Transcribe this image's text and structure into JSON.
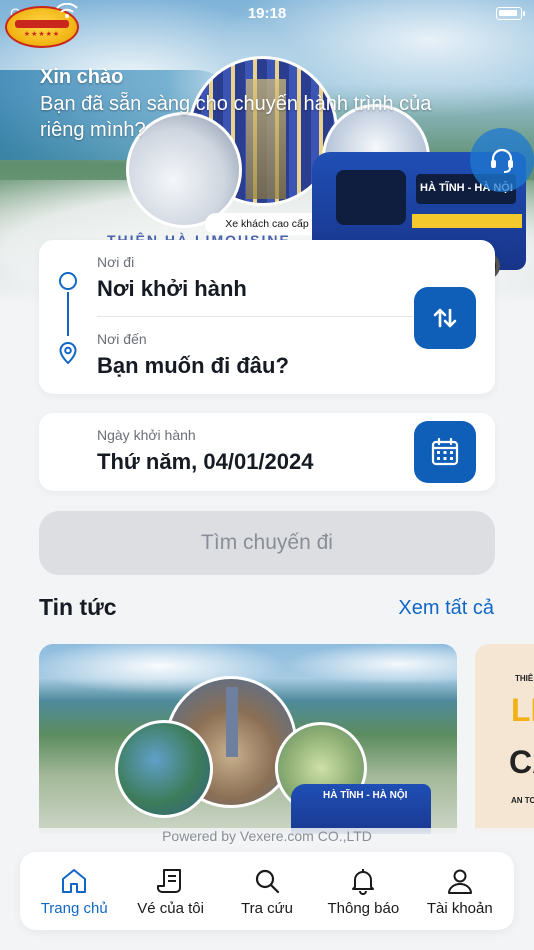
{
  "status_bar": {
    "carrier": "Carrier",
    "time": "19:18"
  },
  "hero": {
    "greeting": "Xin chào",
    "subtitle": "Bạn đã sẵn sàng cho chuyến hành trình của riêng mình?",
    "image_caption": "Xe khách cao cấp",
    "bus_route_text": "HÀ TĨNH - HÀ NỘI",
    "brand_text": "THIÊN HÀ LIMOUSINE"
  },
  "route_form": {
    "from_label": "Nơi đi",
    "from_value": "Nơi khởi hành",
    "to_label": "Nơi đến",
    "to_value": "Bạn muốn đi đâu?"
  },
  "date_form": {
    "label": "Ngày khởi hành",
    "value": "Thứ năm, 04/01/2024"
  },
  "search_button": "Tìm chuyến đi",
  "news": {
    "title": "Tin tức",
    "see_all": "Xem tất cả",
    "card1_bus_text": "HÀ TĨNH - HÀ NỘI",
    "card2_lines": [
      "THIÊ",
      "LI",
      "CA",
      "AN TO"
    ]
  },
  "footer": {
    "powered_by": "Powered by Vexere.com CO.,LTD"
  },
  "tabs": [
    {
      "label": "Trang chủ",
      "icon": "home-icon",
      "active": true
    },
    {
      "label": "Vé của tôi",
      "icon": "ticket-icon",
      "active": false
    },
    {
      "label": "Tra cứu",
      "icon": "search-icon",
      "active": false
    },
    {
      "label": "Thông báo",
      "icon": "bell-icon",
      "active": false
    },
    {
      "label": "Tài khoản",
      "icon": "user-icon",
      "active": false
    }
  ],
  "colors": {
    "accent": "#1167c8",
    "button_dark": "#0f5fb8",
    "disabled_button": "#dcdee2"
  }
}
